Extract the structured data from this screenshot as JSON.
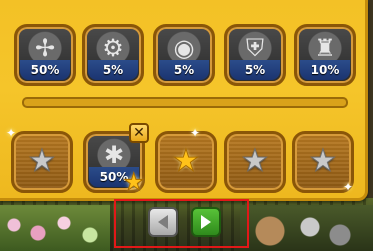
{
  "collection": {
    "items": [
      {
        "name": "windmill",
        "icon": "windmill-icon",
        "glyph": "✢",
        "percent": "50%"
      },
      {
        "name": "robot",
        "icon": "robot-icon",
        "glyph": "⚙",
        "percent": "5%"
      },
      {
        "name": "globe",
        "icon": "snow-globe-icon",
        "glyph": "◉",
        "percent": "5%"
      },
      {
        "name": "armor",
        "icon": "armor-icon",
        "glyph": "⛨",
        "percent": "5%"
      },
      {
        "name": "castle",
        "icon": "castle-icon",
        "glyph": "♜",
        "percent": "10%"
      }
    ]
  },
  "reward_slots": [
    {
      "state": "empty",
      "star": "grey"
    },
    {
      "state": "filled",
      "item_icon": "spider-icon",
      "glyph": "✱",
      "percent": "50%",
      "star": "gold-badge"
    },
    {
      "state": "empty",
      "star": "gold"
    },
    {
      "state": "empty",
      "star": "grey"
    },
    {
      "state": "empty",
      "star": "grey"
    }
  ],
  "close_label": "✕",
  "nav": {
    "prev_icon": "arrow-left-icon",
    "next_icon": "arrow-right-icon"
  },
  "colors": {
    "panel": "#f3c126",
    "percent_bar": "#1b3470",
    "highlight_frame": "#e21818",
    "next_button": "#2f8a1c"
  }
}
